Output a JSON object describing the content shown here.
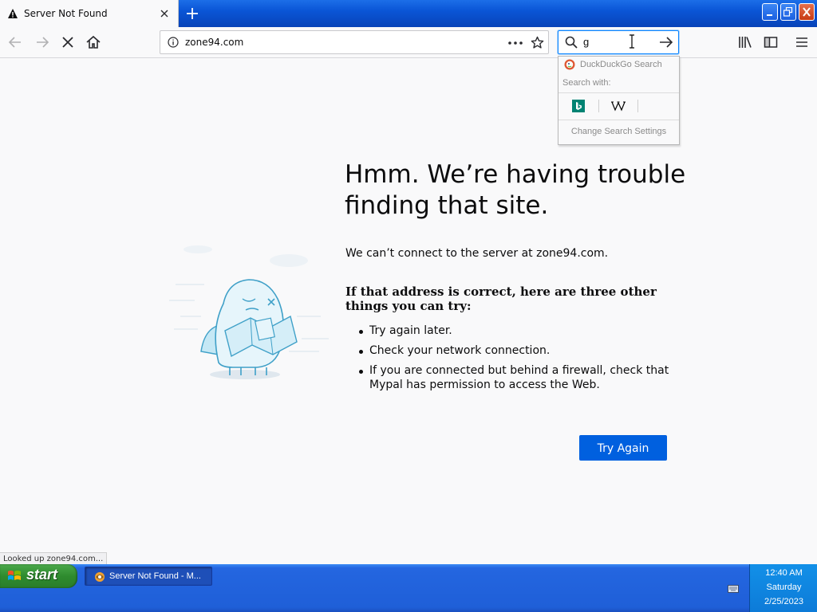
{
  "browser": {
    "tab": {
      "title": "Server Not Found"
    },
    "url": "zone94.com",
    "search": {
      "value": "g"
    },
    "search_popup": {
      "default_engine": "DuckDuckGo Search",
      "search_with_label": "Search with:",
      "engines": [
        "bing-icon",
        "wikipedia-icon"
      ],
      "settings_label": "Change Search Settings"
    }
  },
  "page": {
    "heading": "Hmm. We’re having trouble finding that site.",
    "description": "We can’t connect to the server at zone94.com.",
    "subheading": "If that address is correct, here are three other things you can try:",
    "tips": [
      "Try again later.",
      "Check your network connection.",
      "If you are connected but behind a firewall, check that Mypal has permission to access the Web."
    ],
    "try_again": "Try Again"
  },
  "status_text": "Looked up zone94.com...",
  "taskbar": {
    "start_label": "start",
    "window_label": "Server Not Found - M...",
    "clock": {
      "time": "12:40 AM",
      "day": "Saturday",
      "date": "2/25/2023"
    }
  }
}
